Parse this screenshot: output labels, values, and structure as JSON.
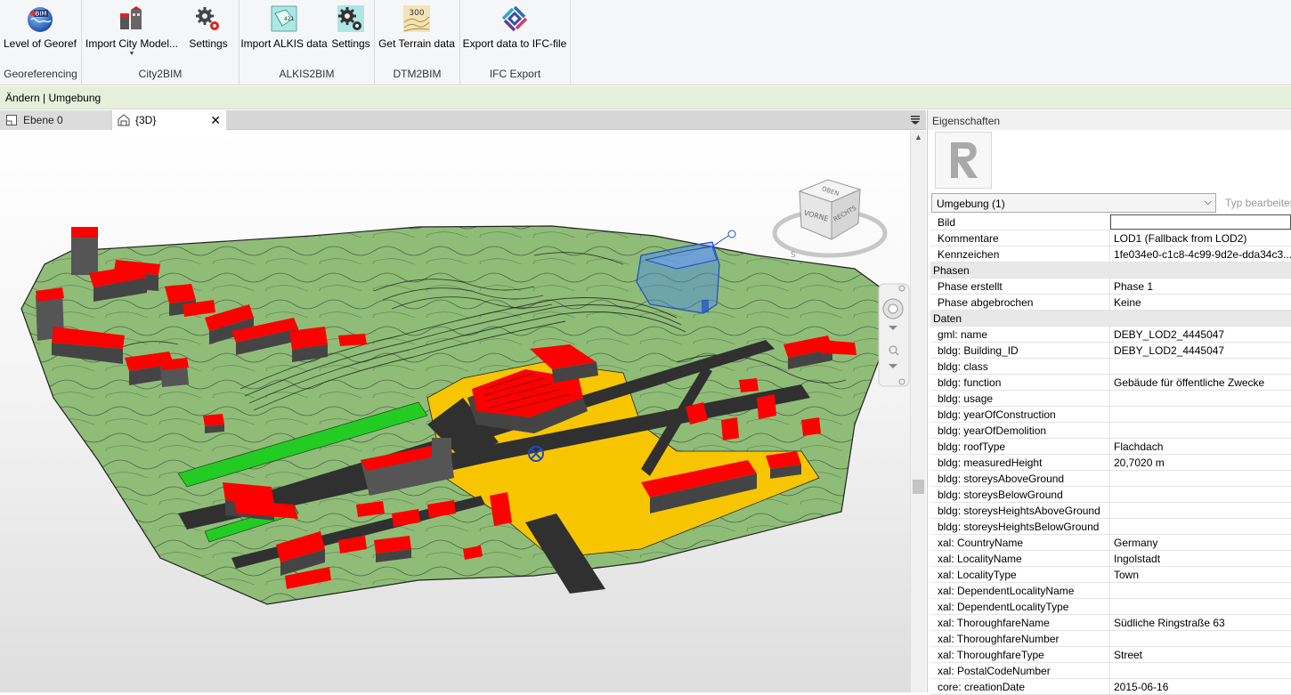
{
  "ribbon": {
    "groups": [
      {
        "title": "Georeferencing",
        "buttons": [
          {
            "label": "Level of Georef",
            "icon": "globe-bim-icon"
          }
        ]
      },
      {
        "title": "City2BIM",
        "buttons": [
          {
            "label": "Import City Model...",
            "icon": "city-model-icon"
          },
          {
            "label": "Settings",
            "icon": "gears-icon"
          }
        ]
      },
      {
        "title": "ALKIS2BIM",
        "buttons": [
          {
            "label": "Import ALKIS data",
            "icon": "alkis-map-icon"
          },
          {
            "label": "Settings",
            "icon": "gears-icon"
          }
        ]
      },
      {
        "title": "DTM2BIM",
        "buttons": [
          {
            "label": "Get Terrain data",
            "icon": "terrain-300-icon",
            "badge": "300"
          }
        ]
      },
      {
        "title": "IFC Export",
        "buttons": [
          {
            "label": "Export data to IFC-file",
            "icon": "ifc-logo-icon"
          }
        ]
      }
    ]
  },
  "context_bar": "Ändern | Umgebung",
  "tabs": [
    {
      "label": "Ebene 0",
      "active": false
    },
    {
      "label": "{3D}",
      "active": true
    }
  ],
  "viewcube": {
    "top": "OBEN",
    "front": "VORNE",
    "right": "RECHTS",
    "compass_s": "S"
  },
  "properties": {
    "title": "Eigenschaften",
    "type_selector": "Umgebung (1)",
    "edit_type": "Typ bearbeiten",
    "rows": [
      {
        "k": "Bild",
        "v": "",
        "editing": true
      },
      {
        "k": "Kommentare",
        "v": "LOD1 (Fallback from LOD2)"
      },
      {
        "k": "Kennzeichen",
        "v": "1fe034e0-c1c8-4c99-9d2e-dda34c3..."
      },
      {
        "section": "Phasen"
      },
      {
        "k": "Phase erstellt",
        "v": "Phase 1"
      },
      {
        "k": "Phase abgebrochen",
        "v": "Keine"
      },
      {
        "section": "Daten"
      },
      {
        "k": "gml: name",
        "v": "DEBY_LOD2_4445047"
      },
      {
        "k": "bldg: Building_ID",
        "v": "DEBY_LOD2_4445047"
      },
      {
        "k": "bldg: class",
        "v": ""
      },
      {
        "k": "bldg: function",
        "v": "Gebäude für öffentliche Zwecke"
      },
      {
        "k": "bldg: usage",
        "v": ""
      },
      {
        "k": "bldg: yearOfConstruction",
        "v": ""
      },
      {
        "k": "bldg: yearOfDemolition",
        "v": ""
      },
      {
        "k": "bldg: roofType",
        "v": "Flachdach"
      },
      {
        "k": "bldg: measuredHeight",
        "v": "20,7020 m"
      },
      {
        "k": "bldg: storeysAboveGround",
        "v": ""
      },
      {
        "k": "bldg: storeysBelowGround",
        "v": ""
      },
      {
        "k": "bldg: storeysHeightsAboveGround",
        "v": ""
      },
      {
        "k": "bldg: storeysHeightsBelowGround",
        "v": ""
      },
      {
        "k": "xal: CountryName",
        "v": "Germany"
      },
      {
        "k": "xal: LocalityName",
        "v": "Ingolstadt"
      },
      {
        "k": "xal: LocalityType",
        "v": "Town"
      },
      {
        "k": "xal: DependentLocalityName",
        "v": ""
      },
      {
        "k": "xal: DependentLocalityType",
        "v": ""
      },
      {
        "k": "xal: ThoroughfareName",
        "v": "Südliche Ringstraße 63"
      },
      {
        "k": "xal: ThoroughfareNumber",
        "v": ""
      },
      {
        "k": "xal: ThoroughfareType",
        "v": "Street"
      },
      {
        "k": "xal: PostalCodeNumber",
        "v": ""
      },
      {
        "k": "core: creationDate",
        "v": "2015-06-16"
      }
    ]
  },
  "colors": {
    "terrain": "#8fbd78",
    "roof": "#ff0000",
    "road": "#303030",
    "plaza": "#f7c600",
    "grass_strip": "#22cc22",
    "selection": "#4a86e8"
  }
}
